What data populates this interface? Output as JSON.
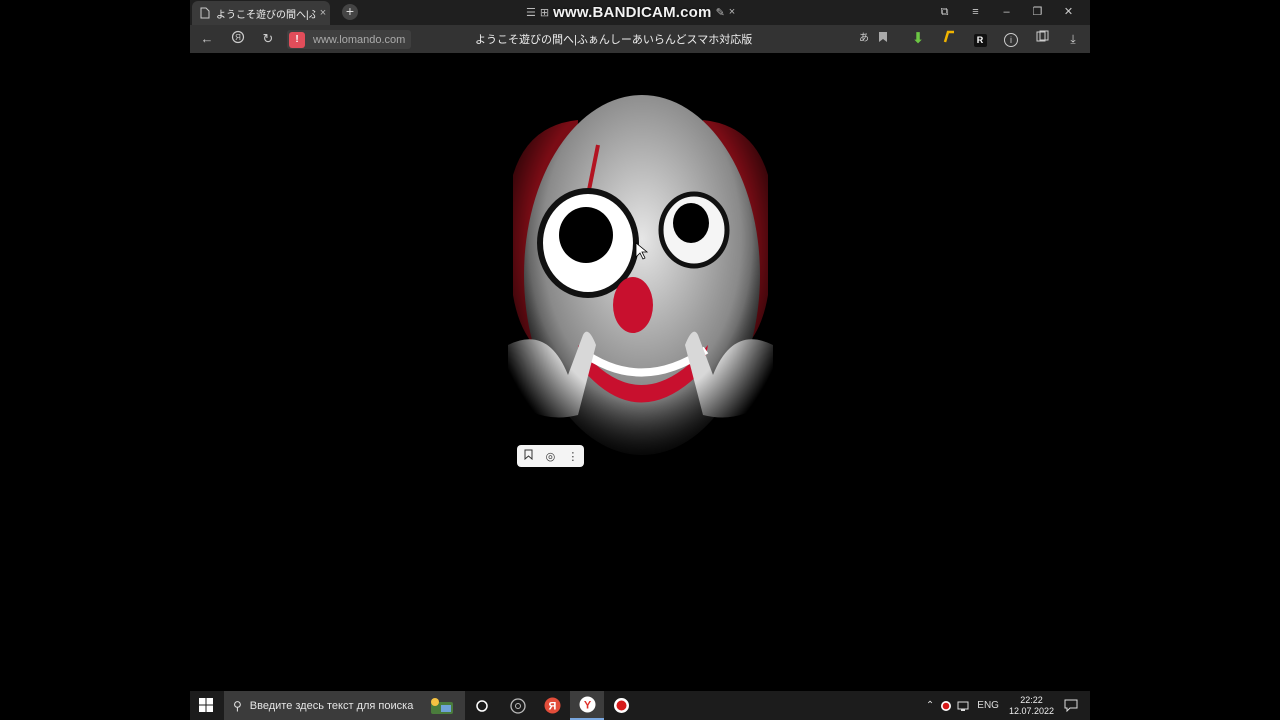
{
  "tab": {
    "title": "ようこそ遊びの間へ|ふぁんしーあいらんどスマホ対応版",
    "close": "×",
    "new": "+"
  },
  "recorder": {
    "watermark": "www.BANDICAM.com"
  },
  "window_controls": {
    "min": "–",
    "max": "❐",
    "close": "✕",
    "menu": "≡",
    "pin": "⧉"
  },
  "address_bar": {
    "url": "www.lomando.com",
    "warning": "!"
  },
  "page": {
    "title": "ようこそ遊びの間へ|ふぁんしーあいらんどスマホ対応版"
  },
  "toolbar_icons": {
    "translate": "あ",
    "bookmark": "🔖",
    "download": "⬇",
    "reader": "R",
    "info": "i"
  },
  "image_toolbar": {
    "save": "⌂",
    "camera": "◎",
    "more": "⋮"
  },
  "taskbar": {
    "search_placeholder": "Введите здесь текст для поиска",
    "language": "ENG",
    "time": "22:22",
    "date": "12.07.2022"
  },
  "colors": {
    "accent_red": "#c8102e",
    "warning": "#e24d5a",
    "taskbar_bg": "#1c1c1c"
  }
}
